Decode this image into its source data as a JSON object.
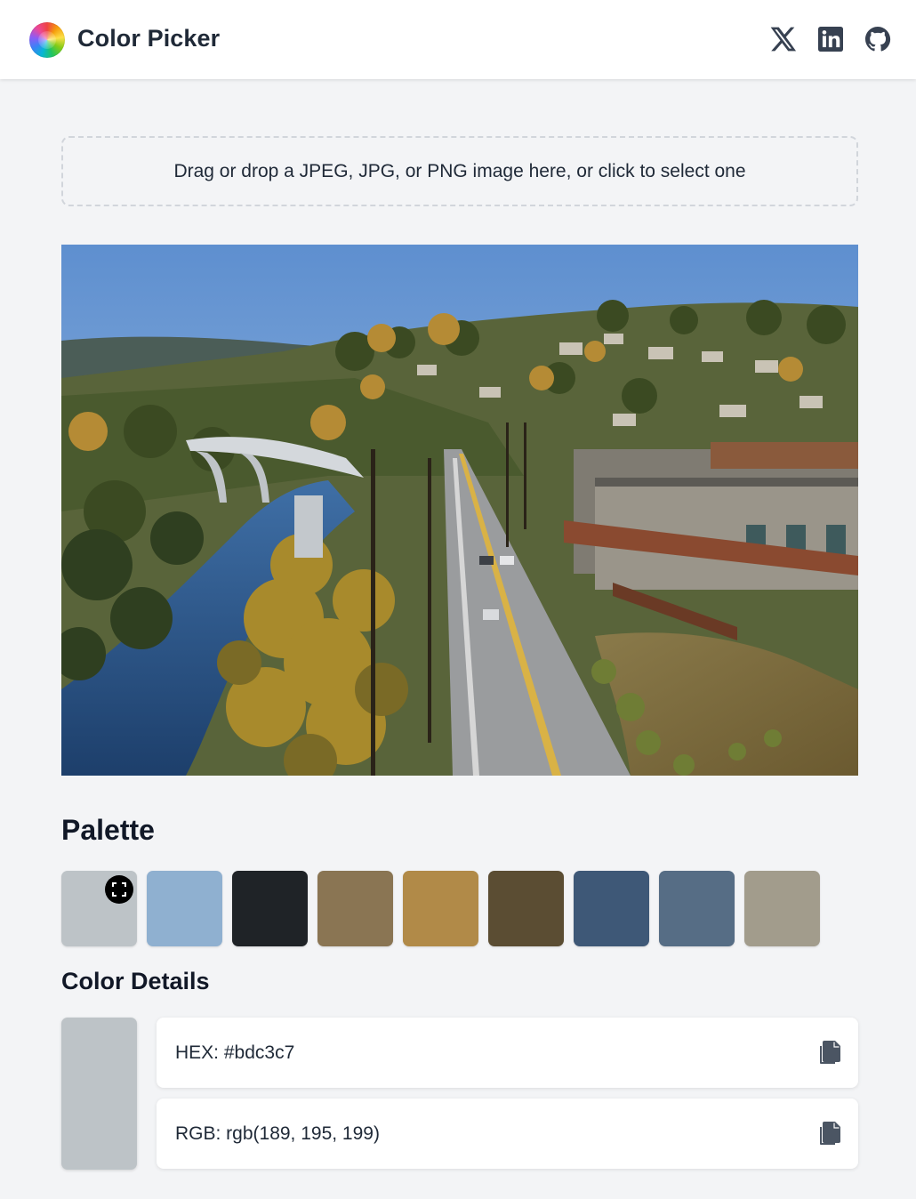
{
  "header": {
    "title": "Color Picker",
    "logo_icon": "color-wheel-icon",
    "social": [
      {
        "name": "x-icon"
      },
      {
        "name": "linkedin-icon"
      },
      {
        "name": "github-icon"
      }
    ]
  },
  "dropzone": {
    "text": "Drag or drop a JPEG, JPG, or PNG image here, or click to select one"
  },
  "palette": {
    "heading": "Palette",
    "colors": [
      "#bdc3c7",
      "#8fb0d0",
      "#1f2327",
      "#8a7553",
      "#b18a48",
      "#5b4d33",
      "#3e5877",
      "#566d85",
      "#a29c8c"
    ],
    "selected_index": 0,
    "selected_icon": "focus-frame-icon"
  },
  "details": {
    "heading": "Color Details",
    "preview_color": "#bdc3c7",
    "hex_text": "HEX: #bdc3c7",
    "rgb_text": "RGB: rgb(189, 195, 199)",
    "copy_icon": "copy-icon"
  }
}
